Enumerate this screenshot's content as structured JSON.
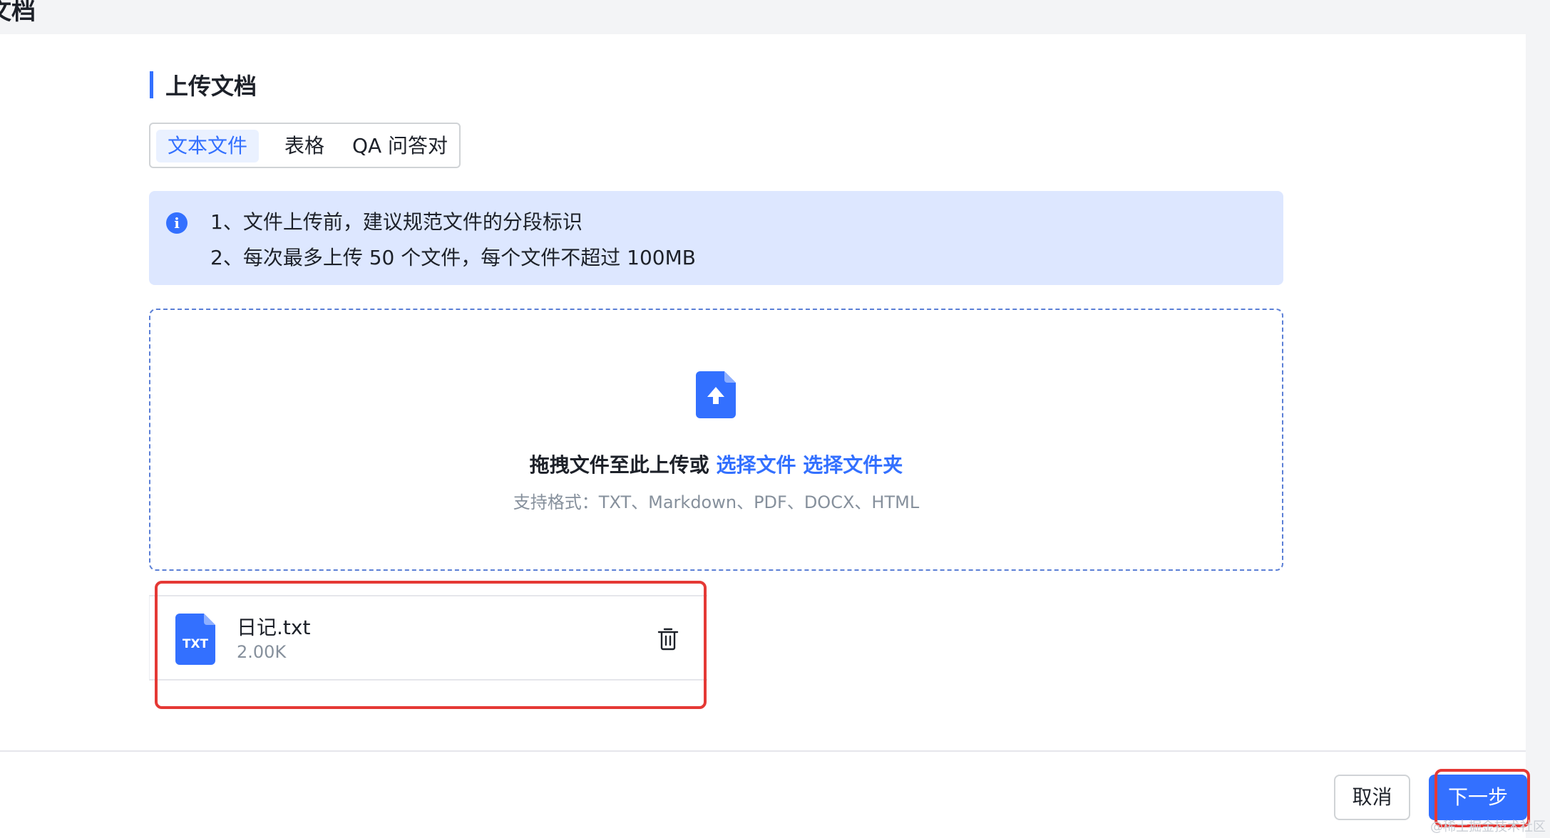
{
  "page": {
    "top_title": "文档"
  },
  "section": {
    "title": "上传文档"
  },
  "tabs": [
    {
      "label": "文本文件",
      "active": true
    },
    {
      "label": "表格",
      "active": false
    },
    {
      "label": "QA 问答对",
      "active": false
    }
  ],
  "notice": {
    "icon": "info-icon",
    "lines": [
      "1、文件上传前，建议规范文件的分段标识",
      "2、每次最多上传 50 个文件，每个文件不超过 100MB"
    ]
  },
  "dropzone": {
    "prompt": "拖拽文件至此上传或",
    "select_file": "选择文件",
    "select_folder": "选择文件夹",
    "formats": "支持格式：TXT、Markdown、PDF、DOCX、HTML"
  },
  "file": {
    "type_label": "TXT",
    "name": "日记.txt",
    "size": "2.00K"
  },
  "footer": {
    "cancel": "取消",
    "next": "下一步"
  },
  "watermark": "@稀土掘金技术社区",
  "colors": {
    "accent": "#3370ff",
    "notice_bg": "#dde7ff",
    "highlight": "#e53935"
  }
}
